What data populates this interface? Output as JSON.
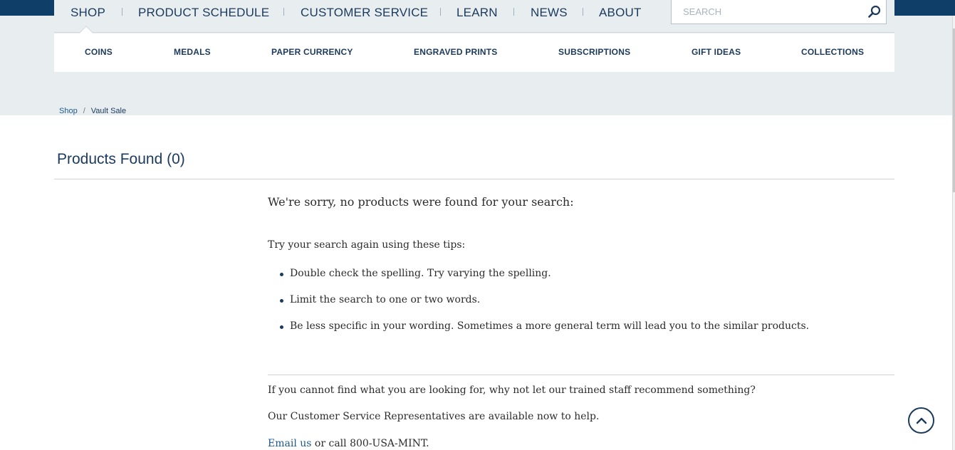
{
  "main_nav": {
    "items": [
      "SHOP",
      "PRODUCT SCHEDULE",
      "CUSTOMER SERVICE",
      "LEARN",
      "NEWS",
      "ABOUT"
    ]
  },
  "search": {
    "placeholder": "SEARCH",
    "icon": "search-icon"
  },
  "sub_nav": {
    "items": [
      "COINS",
      "MEDALS",
      "PAPER CURRENCY",
      "ENGRAVED PRINTS",
      "SUBSCRIPTIONS",
      "GIFT IDEAS",
      "COLLECTIONS"
    ]
  },
  "breadcrumb": {
    "items": [
      "Shop",
      "Vault Sale"
    ],
    "separator": "/"
  },
  "results": {
    "title": "Products Found (0)",
    "sorry": "We're sorry, no products were found for your search:",
    "tips_intro": "Try your search again using these tips:",
    "tips": [
      "Double check the spelling. Try varying the spelling.",
      "Limit the search to one or two words.",
      "Be less specific in your wording. Sometimes a more general term will lead you to the similar products."
    ]
  },
  "help": {
    "line1": "If you cannot find what you are looking for, why not let our trained staff recommend something?",
    "line2": "Our Customer Service Representatives are available now to help.",
    "email_link": "Email us",
    "line3_rest": " or call 800-USA-MINT."
  },
  "colors": {
    "navy": "#1b3a5c",
    "band": "#e8edf0",
    "link": "#1e5a8a"
  },
  "back_to_top_icon": "chevron-up-icon"
}
